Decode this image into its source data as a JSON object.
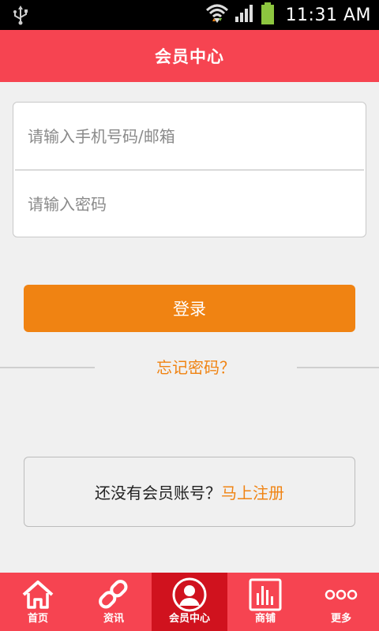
{
  "status_bar": {
    "time": "11:31 AM",
    "icons": [
      "usb-icon",
      "wifi-icon",
      "signal-icon",
      "battery-icon"
    ]
  },
  "header": {
    "title": "会员中心"
  },
  "login_form": {
    "account_placeholder": "请输入手机号码/邮箱",
    "password_placeholder": "请输入密码",
    "login_label": "登录",
    "forgot_label": "忘记密码？"
  },
  "register": {
    "prompt": "还没有会员账号？",
    "link": "马上注册"
  },
  "bottom_nav": {
    "items": [
      {
        "label": "首页",
        "icon": "home-icon",
        "active": false
      },
      {
        "label": "资讯",
        "icon": "link-icon",
        "active": false
      },
      {
        "label": "会员中心",
        "icon": "user-icon",
        "active": true
      },
      {
        "label": "商铺",
        "icon": "bar-chart-icon",
        "active": false
      },
      {
        "label": "更多",
        "icon": "more-icon",
        "active": false
      }
    ]
  },
  "colors": {
    "primary_red": "#f64451",
    "active_red": "#d0121e",
    "accent_orange": "#f08312",
    "background": "#f0f0f0"
  }
}
